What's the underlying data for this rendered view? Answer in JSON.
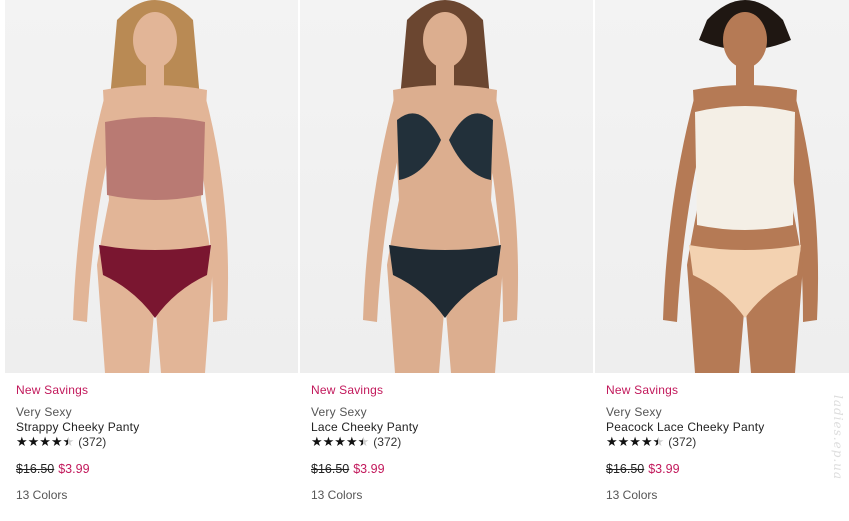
{
  "products": [
    {
      "photo_label": "model-in-mauve-top-and-burgundy-panty",
      "promo": "New Savings",
      "brand": "Very Sexy",
      "name": "Strappy Cheeky Panty",
      "stars": "★★★★",
      "review_count": "(372)",
      "rating": 4.5,
      "old_price": "$16.50",
      "new_price": "$3.99",
      "colors": "13 Colors",
      "palette": {
        "skin": "#e2b597",
        "hair": "#b98a54",
        "top": "#b97a73",
        "bottom": "#7a1630"
      }
    },
    {
      "photo_label": "model-in-black-lace-bra-and-panty",
      "promo": "New Savings",
      "brand": "Very Sexy",
      "name": "Lace Cheeky Panty",
      "stars": "★★★★",
      "review_count": "(372)",
      "rating": 4.5,
      "old_price": "$16.50",
      "new_price": "$3.99",
      "colors": "13 Colors",
      "palette": {
        "skin": "#dcae8f",
        "hair": "#6b4630",
        "top": "#22303a",
        "bottom": "#1f2a33"
      }
    },
    {
      "photo_label": "model-in-white-top-and-peach-lace-panty",
      "promo": "New Savings",
      "brand": "Very Sexy",
      "name": "Peacock Lace Cheeky Panty",
      "stars": "★★★★",
      "review_count": "(372)",
      "rating": 4.5,
      "old_price": "$16.50",
      "new_price": "$3.99",
      "colors": "13 Colors",
      "palette": {
        "skin": "#b57a55",
        "hair": "#1f1712",
        "top": "#f4efe6",
        "bottom": "#f3d2b1"
      }
    }
  ],
  "watermark": "ladies.ep.ua"
}
